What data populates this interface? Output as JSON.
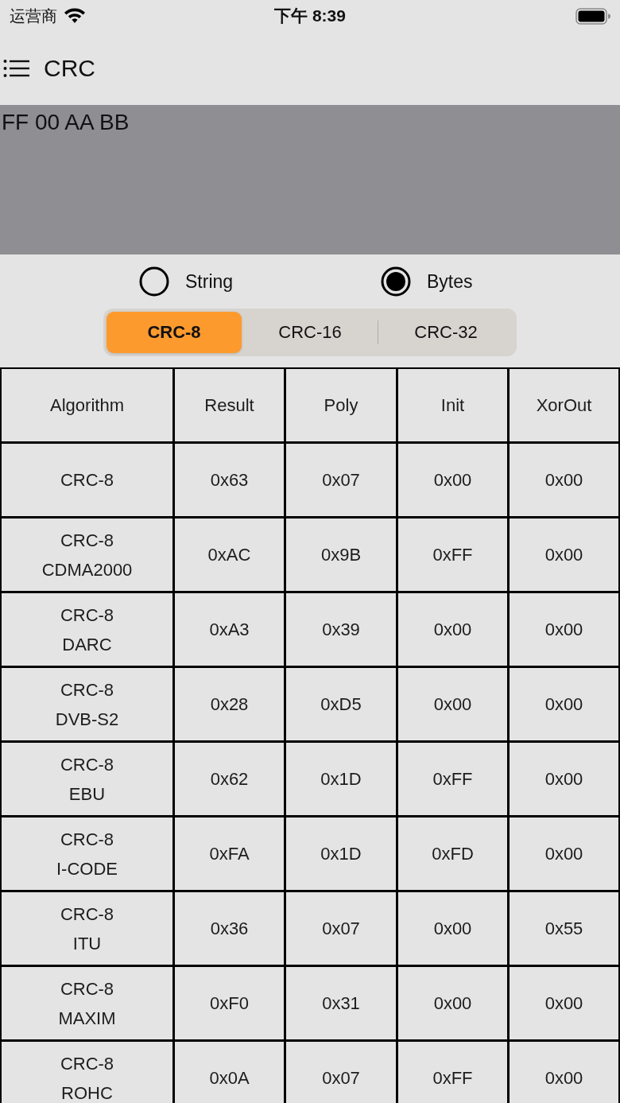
{
  "status_bar": {
    "carrier": "运营商",
    "time": "下午 8:39"
  },
  "nav": {
    "title": "CRC"
  },
  "input": {
    "value": "FF 00 AA BB"
  },
  "input_mode": [
    {
      "label": "String",
      "selected": false
    },
    {
      "label": "Bytes",
      "selected": true
    }
  ],
  "tabs": [
    {
      "label": "CRC-8",
      "selected": true
    },
    {
      "label": "CRC-16",
      "selected": false
    },
    {
      "label": "CRC-32",
      "selected": false
    }
  ],
  "table": {
    "columns": [
      "Algorithm",
      "Result",
      "Poly",
      "Init",
      "XorOut"
    ],
    "rows": [
      [
        "CRC-8",
        "0x63",
        "0x07",
        "0x00",
        "0x00"
      ],
      [
        "CRC-8\nCDMA2000",
        "0xAC",
        "0x9B",
        "0xFF",
        "0x00"
      ],
      [
        "CRC-8\nDARC",
        "0xA3",
        "0x39",
        "0x00",
        "0x00"
      ],
      [
        "CRC-8\nDVB-S2",
        "0x28",
        "0xD5",
        "0x00",
        "0x00"
      ],
      [
        "CRC-8\nEBU",
        "0x62",
        "0x1D",
        "0xFF",
        "0x00"
      ],
      [
        "CRC-8\nI-CODE",
        "0xFA",
        "0x1D",
        "0xFD",
        "0x00"
      ],
      [
        "CRC-8\nITU",
        "0x36",
        "0x07",
        "0x00",
        "0x55"
      ],
      [
        "CRC-8\nMAXIM",
        "0xF0",
        "0x31",
        "0x00",
        "0x00"
      ],
      [
        "CRC-8\nROHC",
        "0x0A",
        "0x07",
        "0xFF",
        "0x00"
      ]
    ]
  }
}
